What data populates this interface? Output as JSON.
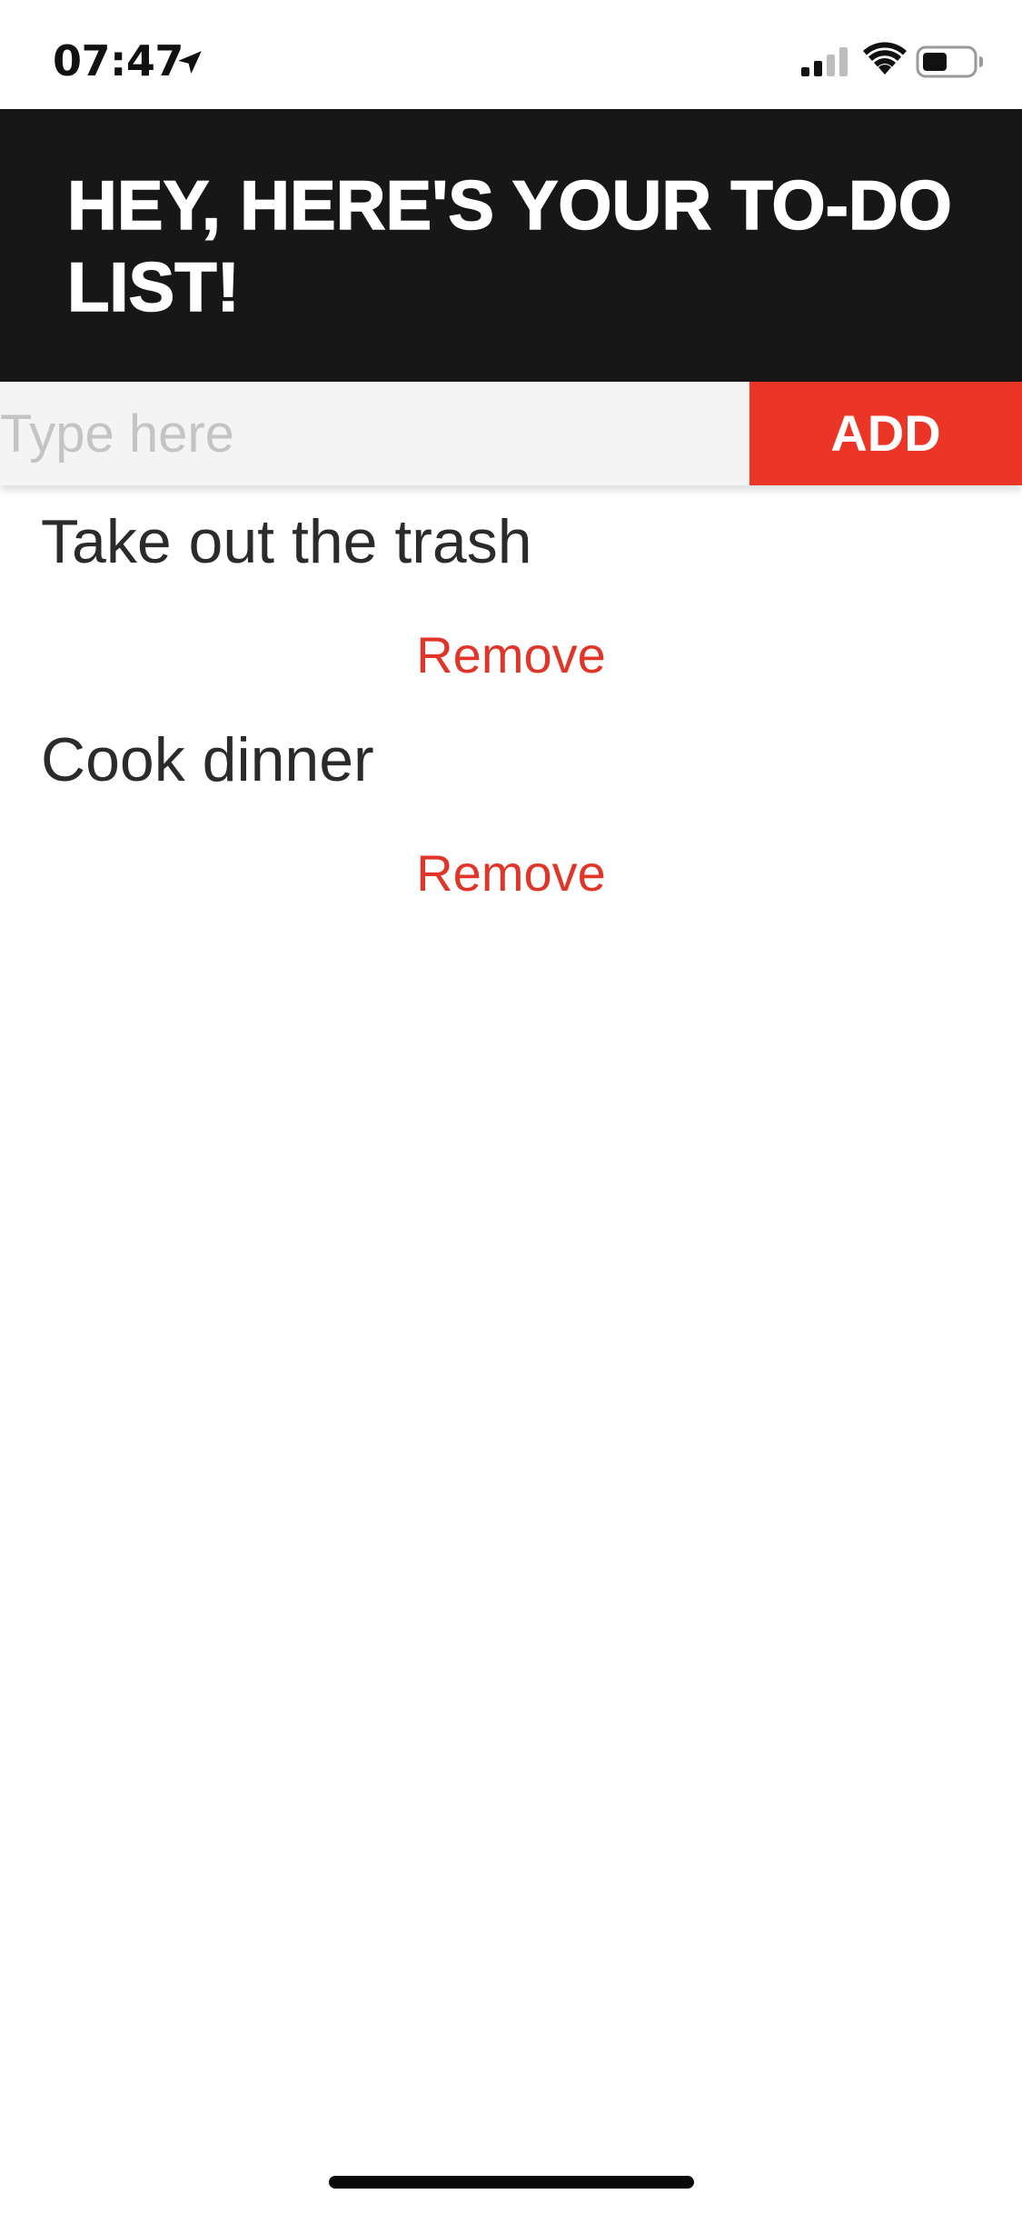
{
  "status_bar": {
    "time": "07:47",
    "icons": [
      "location-arrow-icon",
      "cellular-signal-icon",
      "wifi-icon",
      "battery-icon"
    ]
  },
  "header": {
    "title": "HEY, HERE'S YOUR TO-DO LIST!"
  },
  "input": {
    "placeholder": "Type here",
    "value": "",
    "add_label": "ADD"
  },
  "todos": [
    {
      "text": "Take out the trash",
      "remove_label": "Remove"
    },
    {
      "text": "Cook dinner",
      "remove_label": "Remove"
    }
  ],
  "colors": {
    "header_bg": "#171717",
    "accent": "#eb3527",
    "input_bg": "#f4f4f4",
    "text": "#2b2b2b"
  }
}
